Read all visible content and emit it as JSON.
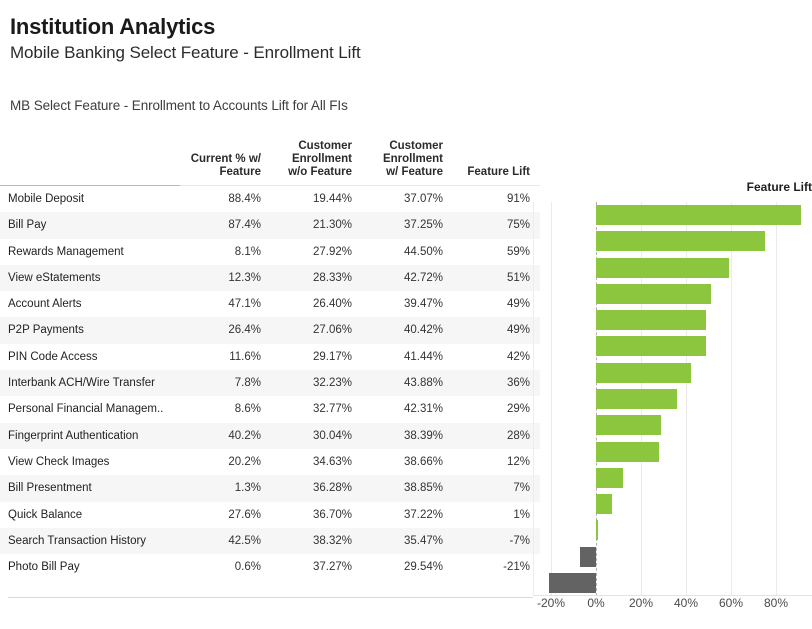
{
  "header": {
    "title": "Institution Analytics",
    "subtitle": "Mobile Banking Select Feature - Enrollment Lift",
    "caption": "MB Select Feature - Enrollment to Accounts Lift for All FIs"
  },
  "table": {
    "columns": [
      "",
      "Current % w/ Feature",
      "Customer Enrollment w/o Feature",
      "Customer Enrollment w/ Feature",
      "Feature Lift"
    ],
    "column_lines": [
      [
        ""
      ],
      [
        "Current % w/",
        "Feature"
      ],
      [
        "Customer",
        "Enrollment",
        "w/o Feature"
      ],
      [
        "Customer",
        "Enrollment",
        "w/ Feature"
      ],
      [
        "Feature Lift"
      ]
    ],
    "rows": [
      {
        "name": "Mobile Deposit",
        "current_pct": "88.4%",
        "enroll_wo": "19.44%",
        "enroll_w": "37.07%",
        "lift": "91%"
      },
      {
        "name": "Bill Pay",
        "current_pct": "87.4%",
        "enroll_wo": "21.30%",
        "enroll_w": "37.25%",
        "lift": "75%"
      },
      {
        "name": "Rewards Management",
        "current_pct": "8.1%",
        "enroll_wo": "27.92%",
        "enroll_w": "44.50%",
        "lift": "59%"
      },
      {
        "name": "View eStatements",
        "current_pct": "12.3%",
        "enroll_wo": "28.33%",
        "enroll_w": "42.72%",
        "lift": "51%"
      },
      {
        "name": "Account Alerts",
        "current_pct": "47.1%",
        "enroll_wo": "26.40%",
        "enroll_w": "39.47%",
        "lift": "49%"
      },
      {
        "name": "P2P Payments",
        "current_pct": "26.4%",
        "enroll_wo": "27.06%",
        "enroll_w": "40.42%",
        "lift": "49%"
      },
      {
        "name": "PIN Code Access",
        "current_pct": "11.6%",
        "enroll_wo": "29.17%",
        "enroll_w": "41.44%",
        "lift": "42%"
      },
      {
        "name": "Interbank ACH/Wire Transfer",
        "current_pct": "7.8%",
        "enroll_wo": "32.23%",
        "enroll_w": "43.88%",
        "lift": "36%"
      },
      {
        "name": "Personal Financial Managem..",
        "current_pct": "8.6%",
        "enroll_wo": "32.77%",
        "enroll_w": "42.31%",
        "lift": "29%"
      },
      {
        "name": "Fingerprint Authentication",
        "current_pct": "40.2%",
        "enroll_wo": "30.04%",
        "enroll_w": "38.39%",
        "lift": "28%"
      },
      {
        "name": "View Check Images",
        "current_pct": "20.2%",
        "enroll_wo": "34.63%",
        "enroll_w": "38.66%",
        "lift": "12%"
      },
      {
        "name": "Bill Presentment",
        "current_pct": "1.3%",
        "enroll_wo": "36.28%",
        "enroll_w": "38.85%",
        "lift": "7%"
      },
      {
        "name": "Quick Balance",
        "current_pct": "27.6%",
        "enroll_wo": "36.70%",
        "enroll_w": "37.22%",
        "lift": "1%"
      },
      {
        "name": "Search Transaction History",
        "current_pct": "42.5%",
        "enroll_wo": "38.32%",
        "enroll_w": "35.47%",
        "lift": "-7%"
      },
      {
        "name": "Photo Bill Pay",
        "current_pct": "0.6%",
        "enroll_wo": "37.27%",
        "enroll_w": "29.54%",
        "lift": "-21%"
      }
    ]
  },
  "chart_data": {
    "type": "bar",
    "orientation": "horizontal",
    "title": "Feature Lift",
    "xlabel": "",
    "ylabel": "",
    "xlim": [
      -28,
      96
    ],
    "xticks": [
      -20,
      0,
      20,
      40,
      60,
      80
    ],
    "xtick_labels": [
      "-20%",
      "0%",
      "20%",
      "40%",
      "60%",
      "80%"
    ],
    "grid": true,
    "legend": false,
    "colors": {
      "positive": "#8cc63f",
      "negative": "#636363"
    },
    "categories": [
      "Mobile Deposit",
      "Bill Pay",
      "Rewards Management",
      "View eStatements",
      "Account Alerts",
      "P2P Payments",
      "PIN Code Access",
      "Interbank ACH/Wire Transfer",
      "Personal Financial Managem..",
      "Fingerprint Authentication",
      "View Check Images",
      "Bill Presentment",
      "Quick Balance",
      "Search Transaction History",
      "Photo Bill Pay"
    ],
    "values": [
      91,
      75,
      59,
      51,
      49,
      49,
      42,
      36,
      29,
      28,
      12,
      7,
      1,
      -7,
      -21
    ]
  }
}
